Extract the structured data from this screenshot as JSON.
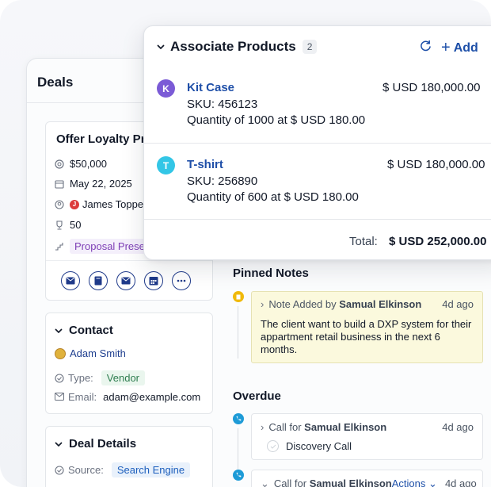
{
  "deals": {
    "title": "Deals",
    "offer": {
      "title": "Offer Loyalty Pro",
      "amount": "$50,000",
      "date": "May 22, 2025",
      "owner_initial": "J",
      "owner": "James Topper",
      "probability": "50",
      "stage": "Proposal Presen"
    },
    "contact": {
      "title": "Contact",
      "name": "Adam Smith",
      "type_label": "Type:",
      "type_value": "Vendor",
      "email_label": "Email:",
      "email_value": "adam@example.com"
    },
    "details": {
      "title": "Deal Details",
      "source_label": "Source:",
      "source_value": "Search Engine"
    }
  },
  "pinned_notes": {
    "title": "Pinned Notes",
    "note": {
      "prefix": "Note Added by",
      "author": "Samual Elkinson",
      "time": "4d ago",
      "body": "The client want to build a DXP system for their appartment  retail business in the next 6 months."
    }
  },
  "overdue": {
    "title": "Overdue",
    "calls": [
      {
        "prefix": "Call for",
        "person": "Samual Elkinson",
        "time": "4d ago",
        "task": "Discovery Call"
      },
      {
        "prefix": "Call for",
        "person": "Samual Elkinson",
        "actions": "Actions",
        "time": "4d ago"
      }
    ]
  },
  "associate_products": {
    "title": "Associate Products",
    "count": "2",
    "add_label": "Add",
    "products": [
      {
        "initial": "K",
        "name": "Kit Case",
        "sku": "SKU: 456123",
        "quantity": "Quantity of 1000 at $ USD 180.00",
        "price": "$ USD 180,000.00",
        "color": "#7b5bd6"
      },
      {
        "initial": "T",
        "name": "T-shirt",
        "sku": "SKU: 256890",
        "quantity": "Quantity of 600 at $ USD 180.00",
        "price": "$ USD 180,000.00",
        "color": "#33c6e6"
      }
    ],
    "total_label": "Total:",
    "total_value": "$ USD 252,000.00"
  },
  "colors": {
    "accent": "#1d4fa8",
    "note_bg": "#fbf9dd",
    "timeline_yellow": "#f0b90b",
    "timeline_blue": "#1e9bd7"
  }
}
